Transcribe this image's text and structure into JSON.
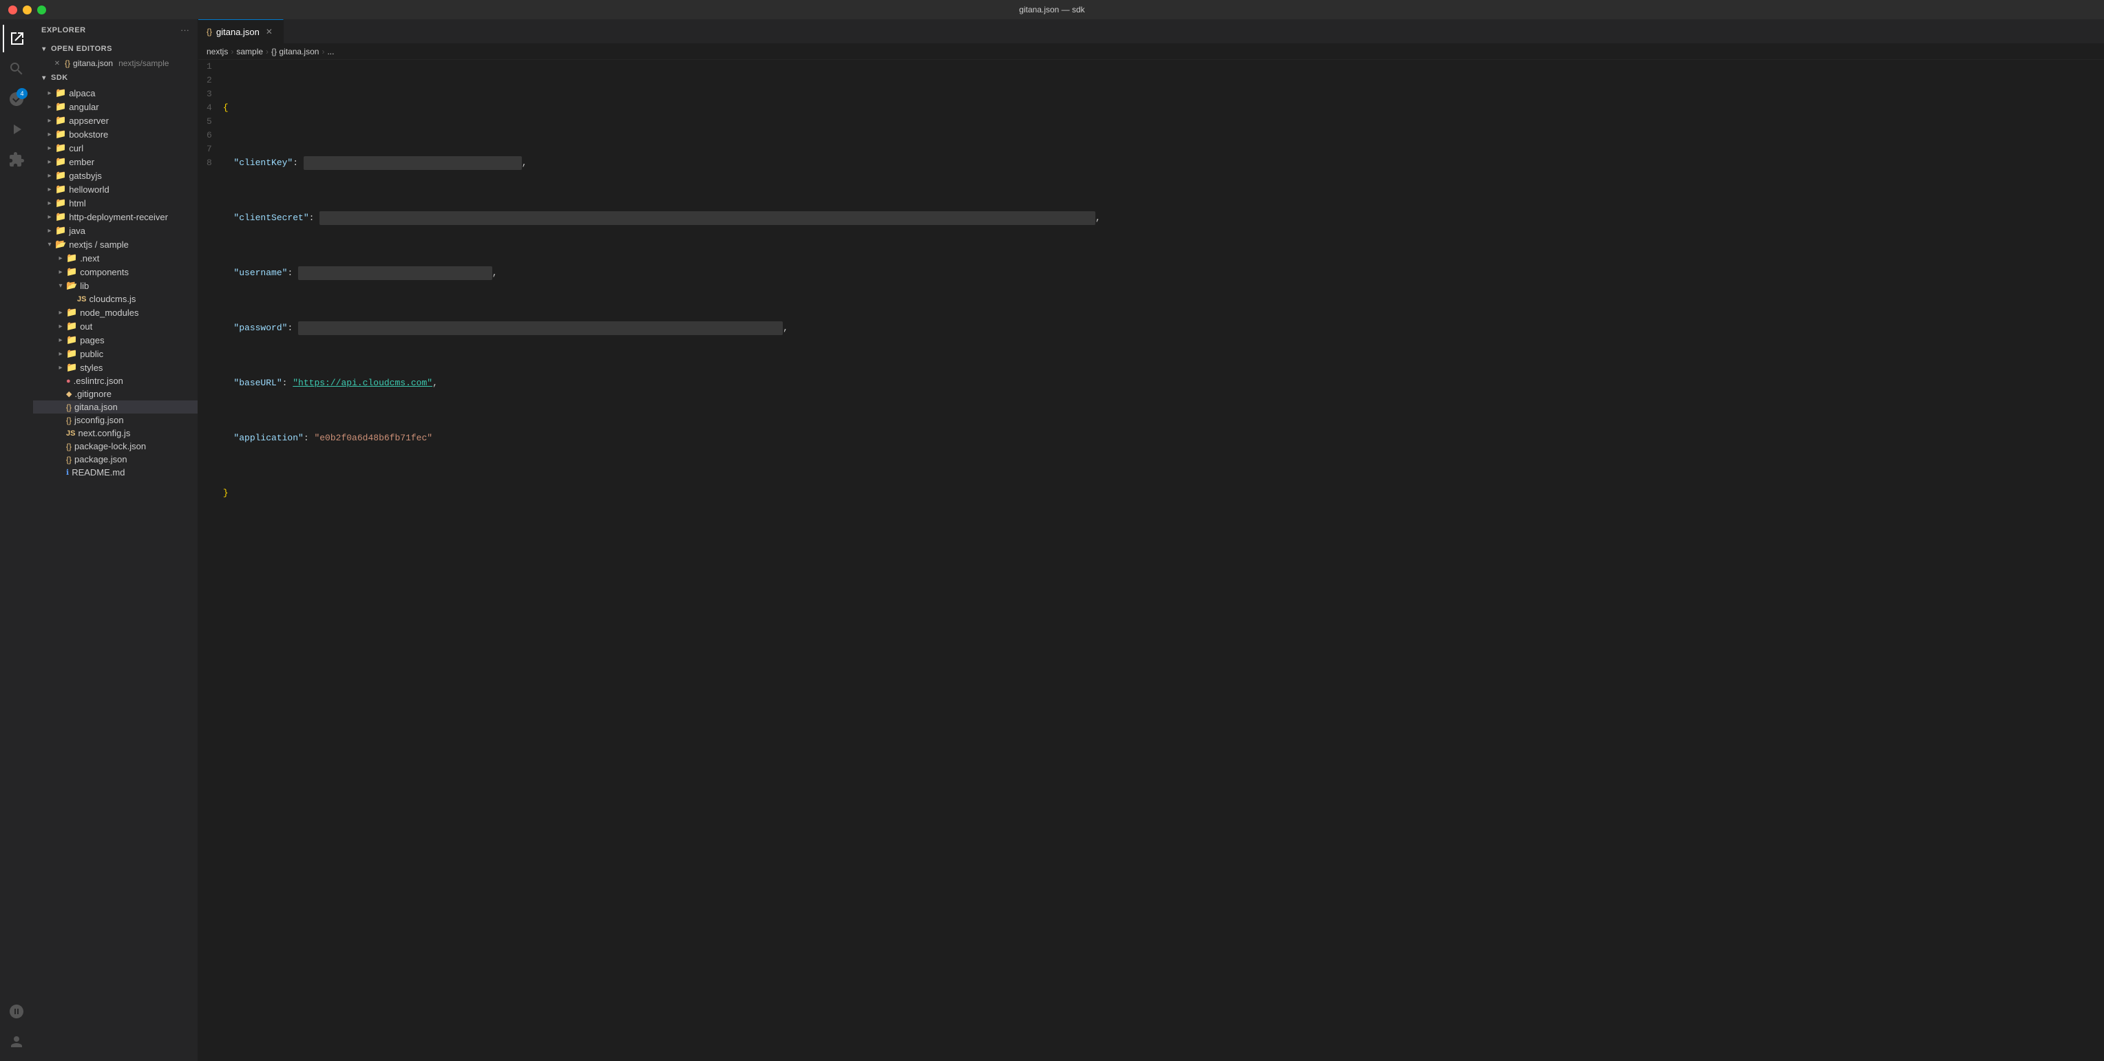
{
  "titlebar": {
    "title": "gitana.json — sdk"
  },
  "activityBar": {
    "icons": [
      {
        "name": "explorer-icon",
        "symbol": "⬜",
        "active": true,
        "badge": null
      },
      {
        "name": "search-icon",
        "symbol": "🔍",
        "active": false,
        "badge": null
      },
      {
        "name": "source-control-icon",
        "symbol": "⑂",
        "active": false,
        "badge": "4"
      },
      {
        "name": "run-icon",
        "symbol": "▷",
        "active": false,
        "badge": null
      },
      {
        "name": "extensions-icon",
        "symbol": "⊞",
        "active": false,
        "badge": null
      }
    ],
    "bottomIcons": [
      {
        "name": "remote-icon",
        "symbol": "⚡",
        "active": false
      },
      {
        "name": "account-icon",
        "symbol": "👤",
        "active": false
      }
    ]
  },
  "sidebar": {
    "title": "Explorer",
    "sections": {
      "openEditors": {
        "label": "Open Editors",
        "expanded": true,
        "items": [
          {
            "closeIcon": "✕",
            "fileType": "json",
            "name": "gitana.json",
            "path": "nextjs/sample"
          }
        ]
      },
      "sdk": {
        "label": "SDK",
        "expanded": true,
        "items": [
          {
            "type": "folder",
            "name": "alpaca",
            "expanded": false,
            "indent": 0
          },
          {
            "type": "folder",
            "name": "angular",
            "expanded": false,
            "indent": 0
          },
          {
            "type": "folder",
            "name": "appserver",
            "expanded": false,
            "indent": 0
          },
          {
            "type": "folder",
            "name": "bookstore",
            "expanded": false,
            "indent": 0
          },
          {
            "type": "folder",
            "name": "curl",
            "expanded": false,
            "indent": 0
          },
          {
            "type": "folder",
            "name": "ember",
            "expanded": false,
            "indent": 0
          },
          {
            "type": "folder",
            "name": "gatsbyjs",
            "expanded": false,
            "indent": 0
          },
          {
            "type": "folder",
            "name": "helloworld",
            "expanded": false,
            "indent": 0
          },
          {
            "type": "folder",
            "name": "html",
            "expanded": false,
            "indent": 0
          },
          {
            "type": "folder",
            "name": "http-deployment-receiver",
            "expanded": false,
            "indent": 0
          },
          {
            "type": "folder",
            "name": "java",
            "expanded": false,
            "indent": 0
          },
          {
            "type": "folder-open",
            "name": "nextjs / sample",
            "expanded": true,
            "indent": 0
          },
          {
            "type": "folder",
            "name": ".next",
            "expanded": false,
            "indent": 1
          },
          {
            "type": "folder",
            "name": "components",
            "expanded": false,
            "indent": 1
          },
          {
            "type": "folder-open",
            "name": "lib",
            "expanded": true,
            "indent": 1
          },
          {
            "type": "file-js",
            "name": "cloudcms.js",
            "indent": 2
          },
          {
            "type": "folder",
            "name": "node_modules",
            "expanded": false,
            "indent": 1
          },
          {
            "type": "folder",
            "name": "out",
            "expanded": false,
            "indent": 1
          },
          {
            "type": "folder",
            "name": "pages",
            "expanded": false,
            "indent": 1
          },
          {
            "type": "folder",
            "name": "public",
            "expanded": false,
            "indent": 1
          },
          {
            "type": "folder",
            "name": "styles",
            "expanded": false,
            "indent": 1
          },
          {
            "type": "file-eslint",
            "name": ".eslintrc.json",
            "indent": 1
          },
          {
            "type": "file-git",
            "name": ".gitignore",
            "indent": 1
          },
          {
            "type": "file-json",
            "name": "gitana.json",
            "indent": 1,
            "selected": true
          },
          {
            "type": "file-json",
            "name": "jsconfig.json",
            "indent": 1
          },
          {
            "type": "file-js",
            "name": "next.config.js",
            "indent": 1
          },
          {
            "type": "file-json",
            "name": "package-lock.json",
            "indent": 1
          },
          {
            "type": "file-json",
            "name": "package.json",
            "indent": 1
          },
          {
            "type": "file-info",
            "name": "README.md",
            "indent": 1
          }
        ]
      }
    }
  },
  "editor": {
    "tab": {
      "name": "gitana.json",
      "icon": "json",
      "closeLabel": "✕"
    },
    "breadcrumb": {
      "parts": [
        "nextjs",
        "sample",
        "{} gitana.json",
        "..."
      ]
    },
    "lines": [
      {
        "num": 1,
        "tokens": [
          {
            "type": "brace",
            "text": "{"
          }
        ]
      },
      {
        "num": 2,
        "tokens": [
          {
            "type": "key",
            "text": "  \"clientKey\""
          },
          {
            "type": "colon",
            "text": ": "
          },
          {
            "type": "redacted",
            "text": "████████████████████████████████"
          },
          {
            "type": "comma",
            "text": ","
          }
        ]
      },
      {
        "num": 3,
        "tokens": [
          {
            "type": "key",
            "text": "  \"clientSecret\""
          },
          {
            "type": "colon",
            "text": ": "
          },
          {
            "type": "redacted-long",
            "text": "████████████████████████████████████████████████████████████████████████████████████████"
          },
          {
            "type": "comma",
            "text": ","
          }
        ]
      },
      {
        "num": 4,
        "tokens": [
          {
            "type": "key",
            "text": "  \"username\""
          },
          {
            "type": "colon",
            "text": ": "
          },
          {
            "type": "redacted",
            "text": "██████████████████████████"
          },
          {
            "type": "comma",
            "text": ","
          }
        ]
      },
      {
        "num": 5,
        "tokens": [
          {
            "type": "key",
            "text": "  \"password\""
          },
          {
            "type": "colon",
            "text": ": "
          },
          {
            "type": "redacted",
            "text": "████████████████████████████████████████████████████"
          },
          {
            "type": "comma",
            "text": ","
          }
        ]
      },
      {
        "num": 6,
        "tokens": [
          {
            "type": "key",
            "text": "  \"baseURL\""
          },
          {
            "type": "colon",
            "text": ": "
          },
          {
            "type": "url",
            "text": "\"https://api.cloudcms.com\""
          },
          {
            "type": "comma",
            "text": ","
          }
        ]
      },
      {
        "num": 7,
        "tokens": [
          {
            "type": "key",
            "text": "  \"application\""
          },
          {
            "type": "colon",
            "text": ": "
          },
          {
            "type": "string",
            "text": "\"e0b2f0a6d48b6fb71fec\""
          }
        ]
      },
      {
        "num": 8,
        "tokens": [
          {
            "type": "brace",
            "text": "}"
          }
        ]
      }
    ]
  }
}
